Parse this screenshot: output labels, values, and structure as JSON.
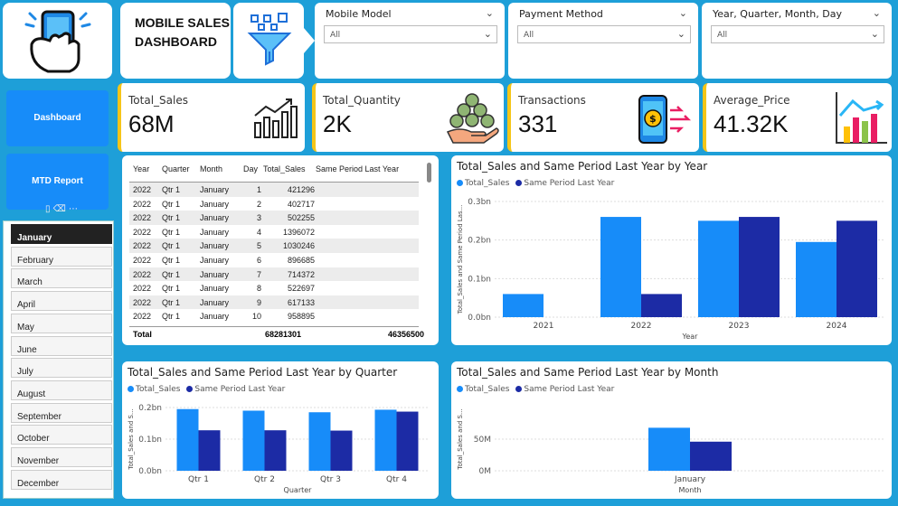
{
  "header": {
    "title_line1": "MOBILE SALES",
    "title_line2": "DASHBOARD"
  },
  "icons": {
    "logo": "phone-hand-icon",
    "filter": "funnel-filter-icon",
    "sales": "bar-chart-up-icon",
    "quantity": "coins-hand-icon",
    "transactions": "phone-payment-icon",
    "avg_price": "chart-arrow-icon"
  },
  "colors": {
    "background": "#1E9FD8",
    "series_current": "#178CF9",
    "series_last": "#1C2BA5",
    "kpi_accent": "#F5C518",
    "nav_button": "#178CF9"
  },
  "slicers": [
    {
      "title": "Mobile Model",
      "value": "All"
    },
    {
      "title": "Payment Method",
      "value": "All"
    },
    {
      "title": "Year, Quarter, Month, Day",
      "value": "All"
    }
  ],
  "nav": {
    "dashboard": "Dashboard",
    "mtd_report": "MTD Report"
  },
  "months": {
    "items": [
      "January",
      "February",
      "March",
      "April",
      "May",
      "June",
      "July",
      "August",
      "September",
      "October",
      "November",
      "December"
    ],
    "selected": "January"
  },
  "kpis": [
    {
      "label": "Total_Sales",
      "value": "68M"
    },
    {
      "label": "Total_Quantity",
      "value": "2K"
    },
    {
      "label": "Transactions",
      "value": "331"
    },
    {
      "label": "Average_Price",
      "value": "41.32K"
    }
  ],
  "table": {
    "columns": [
      "Year",
      "Quarter",
      "Month",
      "Day",
      "Total_Sales",
      "Same Period Last Year"
    ],
    "rows": [
      [
        "2022",
        "Qtr 1",
        "January",
        "1",
        "421296",
        ""
      ],
      [
        "2022",
        "Qtr 1",
        "January",
        "2",
        "402717",
        ""
      ],
      [
        "2022",
        "Qtr 1",
        "January",
        "3",
        "502255",
        ""
      ],
      [
        "2022",
        "Qtr 1",
        "January",
        "4",
        "1396072",
        ""
      ],
      [
        "2022",
        "Qtr 1",
        "January",
        "5",
        "1030246",
        ""
      ],
      [
        "2022",
        "Qtr 1",
        "January",
        "6",
        "896685",
        ""
      ],
      [
        "2022",
        "Qtr 1",
        "January",
        "7",
        "714372",
        ""
      ],
      [
        "2022",
        "Qtr 1",
        "January",
        "8",
        "522697",
        ""
      ],
      [
        "2022",
        "Qtr 1",
        "January",
        "9",
        "617133",
        ""
      ],
      [
        "2022",
        "Qtr 1",
        "January",
        "10",
        "958895",
        ""
      ]
    ],
    "total_label": "Total",
    "total_sales": "68281301",
    "total_last_year": "46356500"
  },
  "chart_data": [
    {
      "type": "bar",
      "title": "Total_Sales and Same Period Last Year by Year",
      "xlabel": "Year",
      "ylabel": "Total_Sales and Same Period Las...",
      "categories": [
        "2021",
        "2022",
        "2023",
        "2024"
      ],
      "series": [
        {
          "name": "Total_Sales",
          "values": [
            0.06,
            0.26,
            0.25,
            0.195
          ]
        },
        {
          "name": "Same Period Last Year",
          "values": [
            0,
            0.06,
            0.26,
            0.25
          ]
        }
      ],
      "yticks": [
        "0.0bn",
        "0.1bn",
        "0.2bn",
        "0.3bn"
      ],
      "ylim": [
        0,
        0.3
      ],
      "unit": "bn",
      "legend": "top-left",
      "grid": true
    },
    {
      "type": "bar",
      "title": "Total_Sales and Same Period Last Year by Quarter",
      "xlabel": "Quarter",
      "ylabel": "Total_Sales and S...",
      "categories": [
        "Qtr 1",
        "Qtr 2",
        "Qtr 3",
        "Qtr 4"
      ],
      "series": [
        {
          "name": "Total_Sales",
          "values": [
            0.195,
            0.19,
            0.185,
            0.193
          ]
        },
        {
          "name": "Same Period Last Year",
          "values": [
            0.128,
            0.128,
            0.127,
            0.187
          ]
        }
      ],
      "yticks": [
        "0.0bn",
        "0.1bn",
        "0.2bn"
      ],
      "ylim": [
        0,
        0.2
      ],
      "unit": "bn",
      "legend": "top-left",
      "grid": true
    },
    {
      "type": "bar",
      "title": "Total_Sales and Same Period Last Year by Month",
      "xlabel": "Month",
      "ylabel": "Total_Sales and S...",
      "categories": [
        "January"
      ],
      "series": [
        {
          "name": "Total_Sales",
          "values": [
            68
          ]
        },
        {
          "name": "Same Period Last Year",
          "values": [
            46
          ]
        }
      ],
      "yticks": [
        "0M",
        "50M"
      ],
      "ylim": [
        0,
        100
      ],
      "unit": "M",
      "legend": "top-left",
      "grid": true
    }
  ]
}
